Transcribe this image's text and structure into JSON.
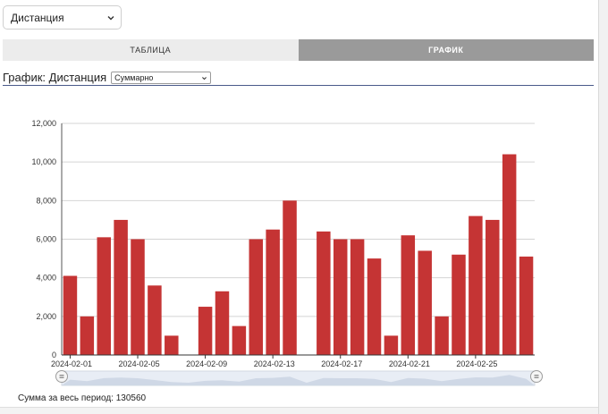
{
  "metric_select": {
    "value": "Дистанция"
  },
  "tabs": [
    {
      "label": "ТАБЛИЦА",
      "active": false
    },
    {
      "label": "ГРАФИК",
      "active": true
    }
  ],
  "chart_header": {
    "title": "График: Дистанция",
    "mode_value": "Суммарно"
  },
  "colors": {
    "bar": "#c53434",
    "active_tab": "#9a9a9a",
    "heading_rule": "#4a5a8a"
  },
  "chart_data": {
    "type": "bar",
    "x": [
      "2024-02-01",
      "2024-02-02",
      "2024-02-03",
      "2024-02-04",
      "2024-02-05",
      "2024-02-06",
      "2024-02-07",
      "2024-02-08",
      "2024-02-09",
      "2024-02-10",
      "2024-02-11",
      "2024-02-12",
      "2024-02-13",
      "2024-02-14",
      "2024-02-15",
      "2024-02-16",
      "2024-02-17",
      "2024-02-18",
      "2024-02-19",
      "2024-02-20",
      "2024-02-21",
      "2024-02-22",
      "2024-02-23",
      "2024-02-24",
      "2024-02-25",
      "2024-02-26",
      "2024-02-27",
      "2024-02-28"
    ],
    "values": [
      4100,
      2000,
      6100,
      7000,
      6000,
      3600,
      1000,
      0,
      2500,
      3300,
      1500,
      6000,
      6500,
      8000,
      0,
      6400,
      6000,
      6000,
      5000,
      1000,
      6200,
      5400,
      2000,
      5200,
      7200,
      7000,
      10400,
      5100
    ],
    "x_tick_labels": [
      "2024-02-01",
      "2024-02-05",
      "2024-02-09",
      "2024-02-13",
      "2024-02-17",
      "2024-02-21",
      "2024-02-25"
    ],
    "y_tick_labels": [
      "0",
      "2,000",
      "4,000",
      "6,000",
      "8,000",
      "10,000",
      "12,000"
    ],
    "y_ticks": [
      0,
      2000,
      4000,
      6000,
      8000,
      10000,
      12000
    ],
    "ylim": [
      0,
      12000
    ],
    "grid": true,
    "range_selector": true
  },
  "summary": {
    "total_label": "Сумма за весь период: 130560"
  }
}
